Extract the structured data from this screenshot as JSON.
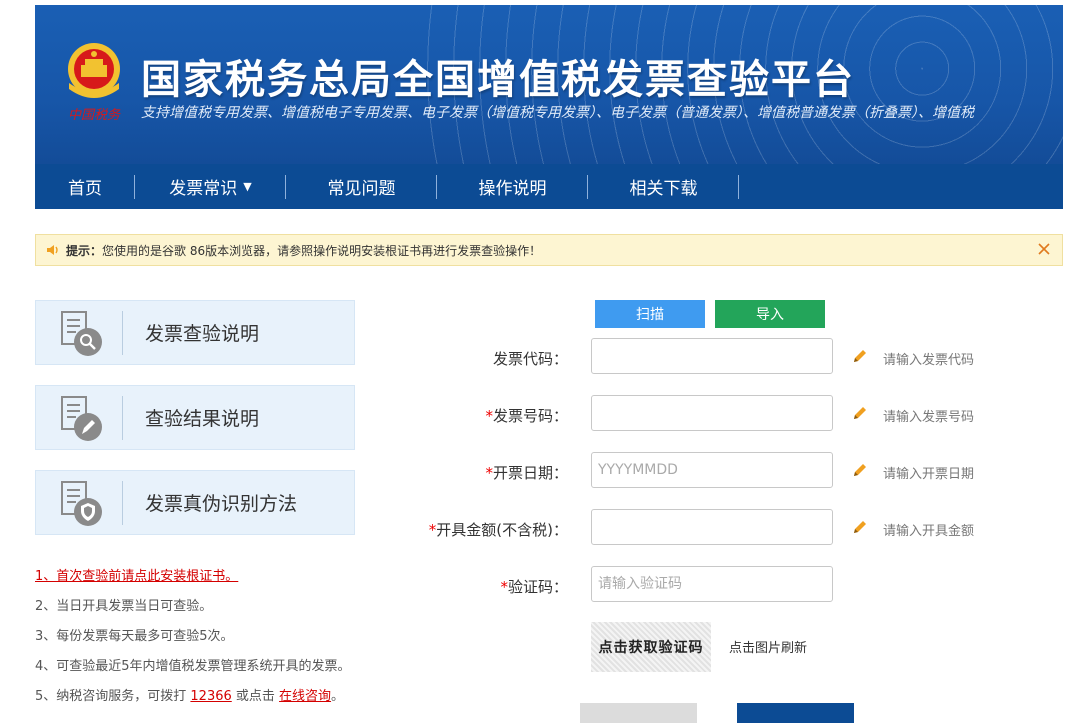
{
  "header": {
    "title": "国家税务总局全国增值税发票查验平台",
    "subtitle": "支持增值税专用发票、增值税电子专用发票、电子发票（增值税专用发票）、电子发票（普通发票）、增值税普通发票（折叠票）、增值税",
    "emblem_icon": "tax-emblem-icon",
    "emblem_colors": {
      "red": "#d7191a",
      "gold": "#f2c230"
    }
  },
  "nav": [
    {
      "label": "首页"
    },
    {
      "label": "发票常识",
      "has_dropdown": true
    },
    {
      "label": "常见问题"
    },
    {
      "label": "操作说明"
    },
    {
      "label": "相关下载"
    }
  ],
  "notice": {
    "label": "提示：",
    "text": "您使用的是谷歌 86版本浏览器，请参照操作说明安装根证书再进行发票查验操作！"
  },
  "cards": [
    {
      "label": "发票查验说明",
      "icon": "document-search-icon"
    },
    {
      "label": "查验结果说明",
      "icon": "document-edit-icon"
    },
    {
      "label": "发票真伪识别方法",
      "icon": "document-shield-icon"
    }
  ],
  "tips": {
    "t1": "1、首次查验前请点此安装根证书。",
    "t2": "2、当日开具发票当日可查验。",
    "t3": "3、每份发票每天最多可查验5次。",
    "t4": "4、可查验最近5年内增值税发票管理系统开具的发票。",
    "t5_prefix": "5、纳税咨询服务，可拨打 ",
    "t5_phone": "12366",
    "t5_mid": " 或点击 ",
    "t5_link": "在线咨询",
    "t5_suffix": "。"
  },
  "form": {
    "scan_label": "扫描",
    "import_label": "导入",
    "fields": [
      {
        "required": "",
        "label": "发票代码：",
        "placeholder": "",
        "hint": "请输入发票代码"
      },
      {
        "required": "*",
        "label": "发票号码：",
        "placeholder": "",
        "hint": "请输入发票号码"
      },
      {
        "required": "*",
        "label": "开票日期：",
        "placeholder": "YYYYMMDD",
        "hint": "请输入开票日期"
      },
      {
        "required": "*",
        "label": "开具金额(不含税)：",
        "placeholder": "",
        "hint": "请输入开具金额"
      },
      {
        "required": "*",
        "label": "验证码：",
        "placeholder": "请输入验证码",
        "hint": ""
      }
    ],
    "captcha_text": "点击获取验证码",
    "refresh_label": "点击图片刷新"
  }
}
